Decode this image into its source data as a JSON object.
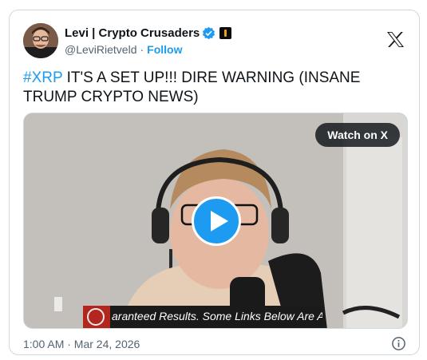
{
  "author": {
    "display_name": "Levi | Crypto Crusaders",
    "handle": "@LeviRietveld",
    "separator": "·",
    "follow_label": "Follow",
    "verified_icon": "verified-badge-icon",
    "affiliate_icon": "affiliate-badge-icon",
    "avatar": "avatar"
  },
  "platform_logo": "x-logo-icon",
  "tweet": {
    "hashtag": "#XRP",
    "text": " IT'S A SET UP!!! DIRE WARNING (INSANE TRUMP CRYPTO NEWS)"
  },
  "video": {
    "watch_label": "Watch on X",
    "play_icon": "play-icon",
    "ticker_text": "aranteed Results. Some Links Below Are Af"
  },
  "footer": {
    "timestamp": "1:00 AM · Mar 24, 2026",
    "info_icon": "info-icon"
  },
  "colors": {
    "accent": "#1d9bf0",
    "text_primary": "#0f1419",
    "text_secondary": "#536471",
    "border": "#cfd9de"
  }
}
